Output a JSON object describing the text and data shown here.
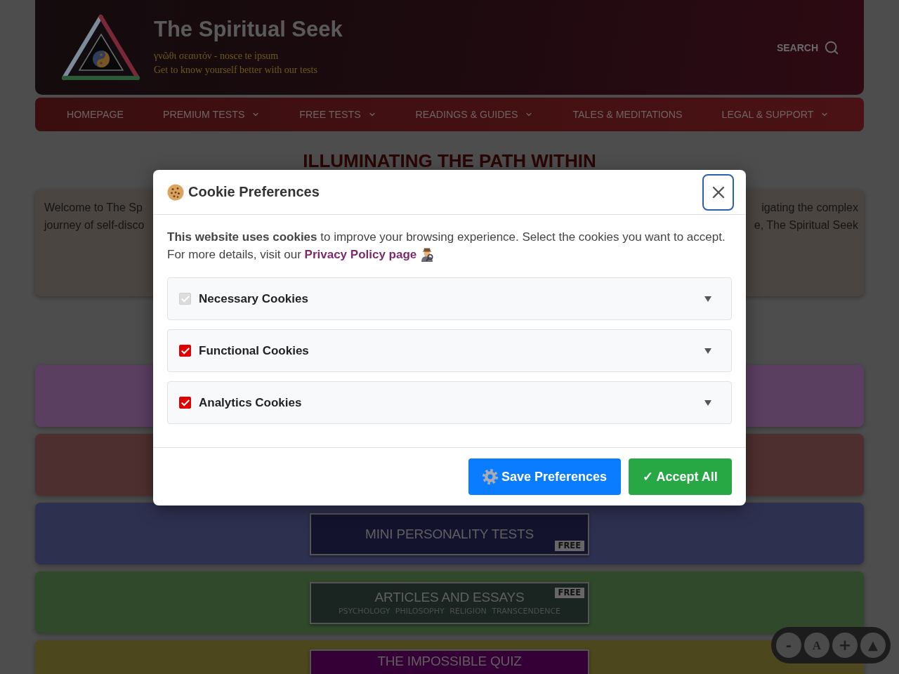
{
  "header": {
    "title": "The Spiritual Seek",
    "taglines": [
      "γνῶθι σεαυτόν - nosce te ipsum",
      "Get to know yourself better with our tests"
    ],
    "search_label": "SEARCH"
  },
  "nav": [
    {
      "label": "HOMEPAGE",
      "has_menu": false
    },
    {
      "label": "PREMIUM TESTS",
      "has_menu": true
    },
    {
      "label": "FREE TESTS",
      "has_menu": true
    },
    {
      "label": "READINGS & GUIDES",
      "has_menu": true
    },
    {
      "label": "TALES & MEDITATIONS",
      "has_menu": false
    },
    {
      "label": "LEGAL & SUPPORT",
      "has_menu": true
    }
  ],
  "heading": "ILLUMINATING THE PATH WITHIN",
  "welcome": {
    "left_lines": [
      "Welcome to The Sp",
      "journey of self-disco"
    ],
    "right_lines": [
      "igating the complex",
      "e, The Spiritual Seek"
    ]
  },
  "sections": [
    {
      "color": "#5b3f61"
    },
    {
      "color": "#4e2f2f"
    },
    {
      "color": "#2e3050",
      "card": {
        "color": "#13132e",
        "title": "MINI PERSONALITY TESTS",
        "badge": "FREE"
      }
    },
    {
      "color": "#30492a",
      "card": {
        "color": "#1a2521",
        "title": "ARTICLES AND ESSAYS",
        "subtitle": "PSYCHOLOGY PHILOSOPHY RELIGION TRANSCENDENCE",
        "badge": "FREE"
      }
    },
    {
      "color": "#4d471e",
      "card": {
        "color": "#350035",
        "title": "THE IMPOSSIBLE QUIZ"
      }
    }
  ],
  "cookie_dialog": {
    "title": "Cookie Preferences",
    "close_button": {
      "focused": true
    },
    "notice": "**This website uses cookies** to improve your browsing experience. Select the cookies you want to accept.",
    "details": "For more details, visit our",
    "link": "Privacy Policy page",
    "categories": [
      {
        "label": "Necessary Cookies",
        "checked": true,
        "disabled": true,
        "expanded": false
      },
      {
        "label": "Functional Cookies",
        "checked": true,
        "disabled": false,
        "expanded": false
      },
      {
        "label": "Analytics Cookies",
        "checked": true,
        "disabled": false,
        "expanded": false
      }
    ],
    "buttons": [
      {
        "kind": "save",
        "label": "Save Preferences"
      },
      {
        "kind": "accept",
        "label": "✓ Accept All"
      }
    ]
  },
  "font_controls": [
    {
      "kind": "smaller",
      "label": "-"
    },
    {
      "kind": "reset",
      "label": "A"
    },
    {
      "kind": "larger",
      "label": "+"
    },
    {
      "kind": "top",
      "label": "▲"
    }
  ]
}
